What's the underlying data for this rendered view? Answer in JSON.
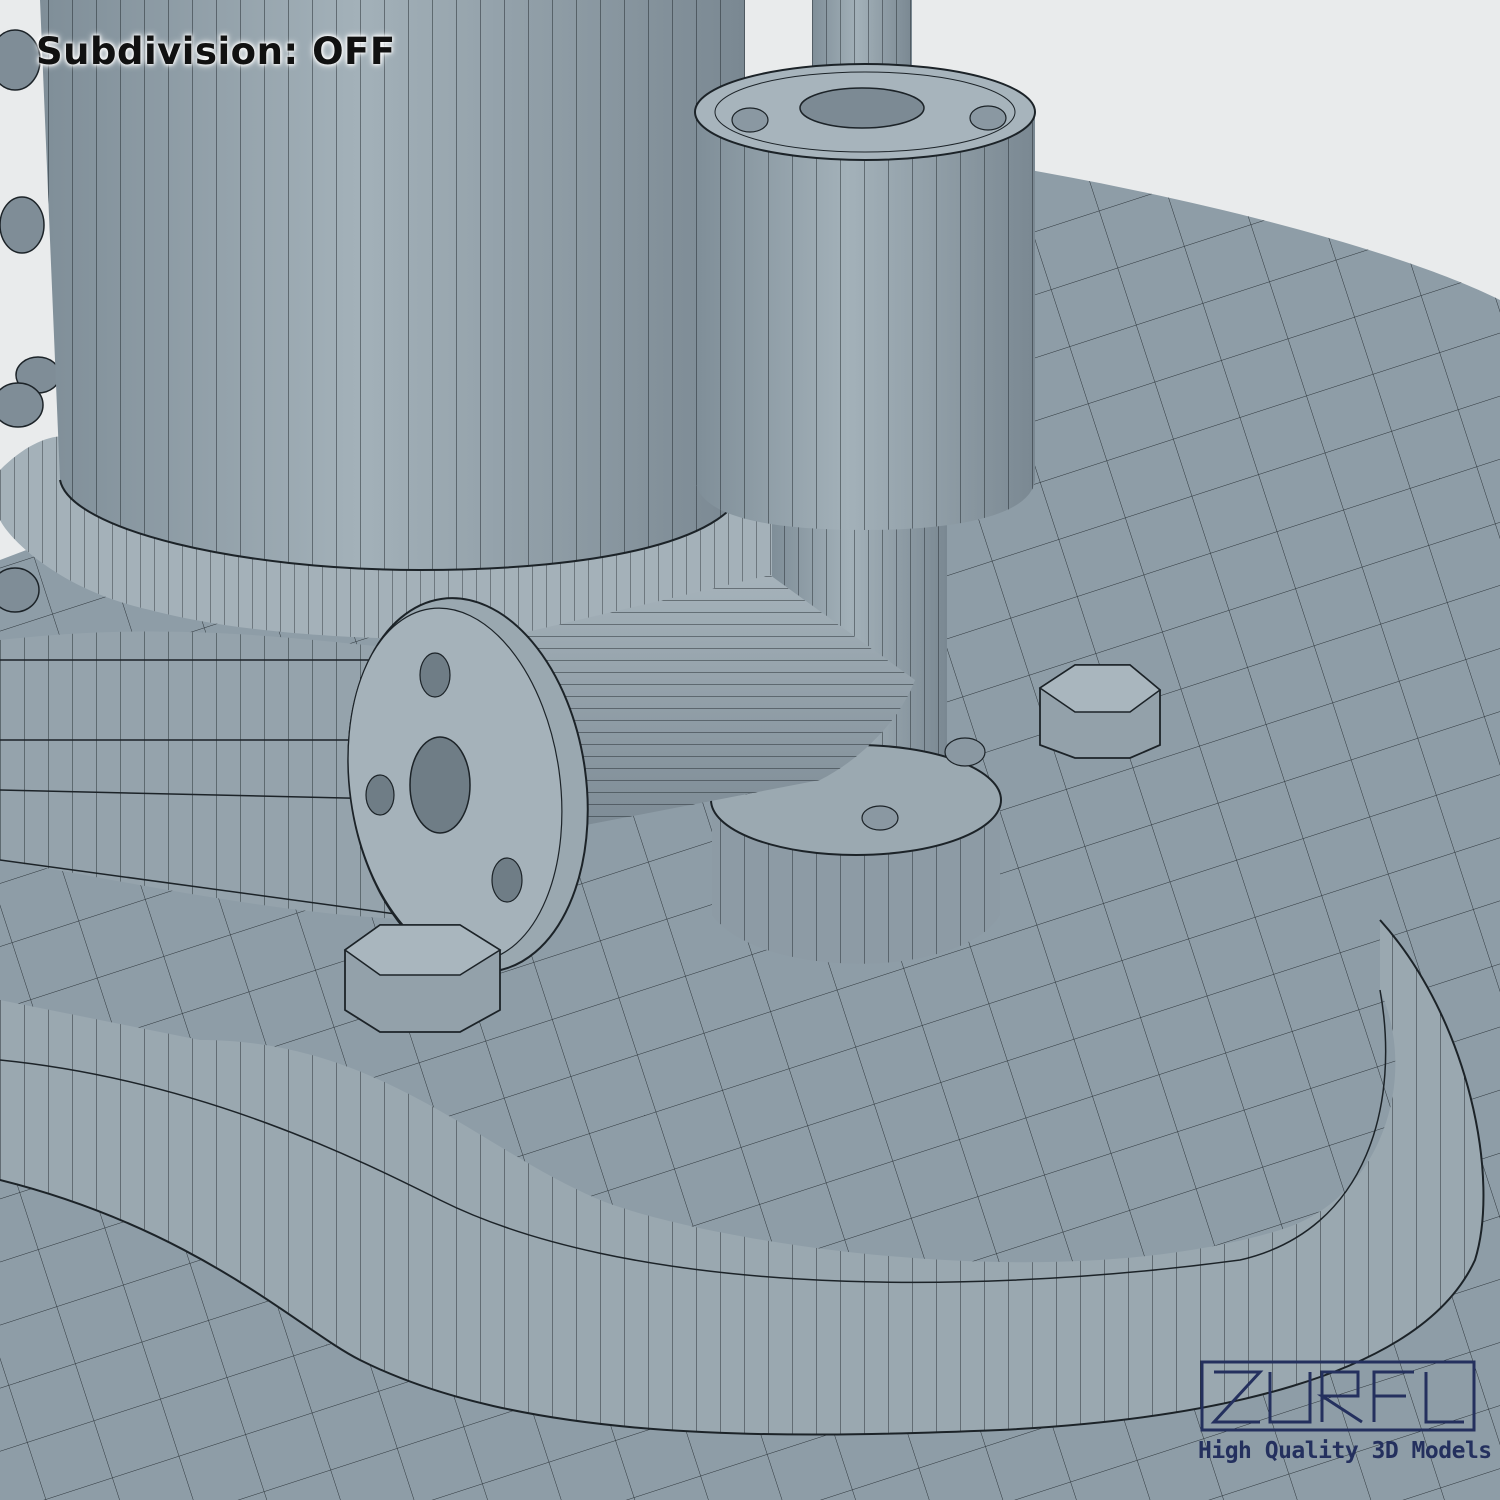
{
  "viewport": {
    "subdivision_label": "Subdivision: OFF",
    "colors": {
      "background": "#e9ebec",
      "mesh_fill": "#8b9aa4",
      "mesh_light": "#a9b6be",
      "mesh_dark": "#6f7d86",
      "wire": "#1c2328"
    }
  },
  "watermark": {
    "logo_text": "ZUREL",
    "tagline": "High Quality 3D Models",
    "color": "#24305e"
  }
}
